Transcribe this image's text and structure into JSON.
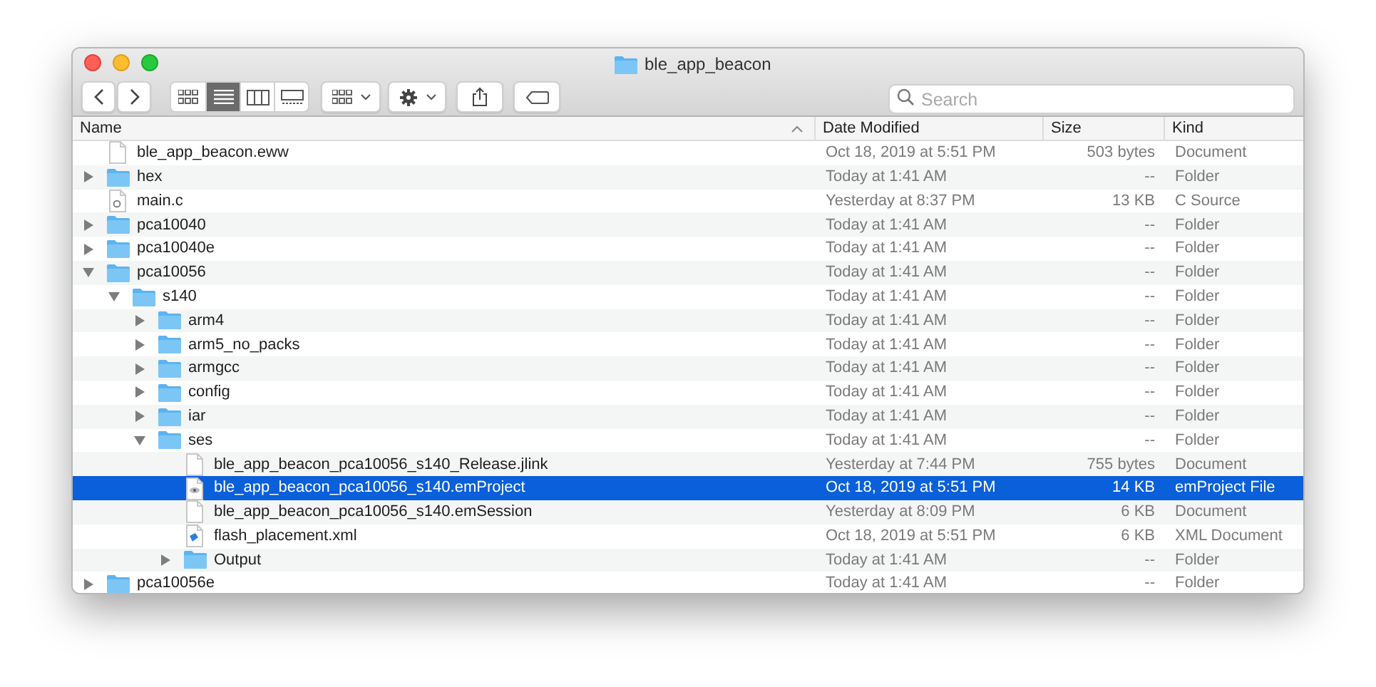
{
  "window": {
    "title": "ble_app_beacon"
  },
  "view_modes": [
    {
      "kind": "icons",
      "selected": false
    },
    {
      "kind": "list",
      "selected": true
    },
    {
      "kind": "columns",
      "selected": false
    },
    {
      "kind": "gallery",
      "selected": false
    }
  ],
  "search": {
    "placeholder": "Search"
  },
  "table": {
    "columns": [
      {
        "label": "Name",
        "sorted": true
      },
      {
        "label": "Date Modified",
        "sorted": false
      },
      {
        "label": "Size",
        "sorted": false
      },
      {
        "label": "Kind",
        "sorted": false
      }
    ],
    "rows": [
      {
        "name": "ble_app_beacon.eww",
        "kind": "document",
        "date": "Oct 18, 2019 at 5:51 PM",
        "size": "503 bytes",
        "type": "Document",
        "selected": false
      },
      {
        "name": "hex",
        "kind": "folder",
        "expanded": false,
        "date": "Today at 1:41 AM",
        "size": "--",
        "type": "Folder",
        "selected": false
      },
      {
        "name": "main.c",
        "kind": "c-source",
        "date": "Yesterday at 8:37 PM",
        "size": "13 KB",
        "type": "C Source",
        "selected": false
      },
      {
        "name": "pca10040",
        "kind": "folder",
        "expanded": false,
        "date": "Today at 1:41 AM",
        "size": "--",
        "type": "Folder",
        "selected": false
      },
      {
        "name": "pca10040e",
        "kind": "folder",
        "expanded": false,
        "date": "Today at 1:41 AM",
        "size": "--",
        "type": "Folder",
        "selected": false
      },
      {
        "name": "pca10056",
        "kind": "folder",
        "expanded": true,
        "date": "Today at 1:41 AM",
        "size": "--",
        "type": "Folder",
        "selected": false,
        "children": [
          {
            "name": "s140",
            "kind": "folder",
            "expanded": true,
            "date": "Today at 1:41 AM",
            "size": "--",
            "type": "Folder",
            "selected": false,
            "children": [
              {
                "name": "arm4",
                "kind": "folder",
                "expanded": false,
                "date": "Today at 1:41 AM",
                "size": "--",
                "type": "Folder",
                "selected": false
              },
              {
                "name": "arm5_no_packs",
                "kind": "folder",
                "expanded": false,
                "date": "Today at 1:41 AM",
                "size": "--",
                "type": "Folder",
                "selected": false
              },
              {
                "name": "armgcc",
                "kind": "folder",
                "expanded": false,
                "date": "Today at 1:41 AM",
                "size": "--",
                "type": "Folder",
                "selected": false
              },
              {
                "name": "config",
                "kind": "folder",
                "expanded": false,
                "date": "Today at 1:41 AM",
                "size": "--",
                "type": "Folder",
                "selected": false
              },
              {
                "name": "iar",
                "kind": "folder",
                "expanded": false,
                "date": "Today at 1:41 AM",
                "size": "--",
                "type": "Folder",
                "selected": false
              },
              {
                "name": "ses",
                "kind": "folder",
                "expanded": true,
                "date": "Today at 1:41 AM",
                "size": "--",
                "type": "Folder",
                "selected": false,
                "children": [
                  {
                    "name": "ble_app_beacon_pca10056_s140_Release.jlink",
                    "kind": "document",
                    "date": "Yesterday at 7:44 PM",
                    "size": "755 bytes",
                    "type": "Document",
                    "selected": false
                  },
                  {
                    "name": "ble_app_beacon_pca10056_s140.emProject",
                    "kind": "project",
                    "date": "Oct 18, 2019 at 5:51 PM",
                    "size": "14 KB",
                    "type": "emProject File",
                    "selected": true
                  },
                  {
                    "name": "ble_app_beacon_pca10056_s140.emSession",
                    "kind": "document",
                    "date": "Yesterday at 8:09 PM",
                    "size": "6 KB",
                    "type": "Document",
                    "selected": false
                  },
                  {
                    "name": "flash_placement.xml",
                    "kind": "xml",
                    "date": "Oct 18, 2019 at 5:51 PM",
                    "size": "6 KB",
                    "type": "XML Document",
                    "selected": false
                  },
                  {
                    "name": "Output",
                    "kind": "folder",
                    "expanded": false,
                    "date": "Today at 1:41 AM",
                    "size": "--",
                    "type": "Folder",
                    "selected": false
                  }
                ]
              }
            ]
          }
        ]
      },
      {
        "name": "pca10056e",
        "kind": "folder",
        "expanded": false,
        "date": "Today at 1:41 AM",
        "size": "--",
        "type": "Folder",
        "selected": false
      }
    ]
  }
}
